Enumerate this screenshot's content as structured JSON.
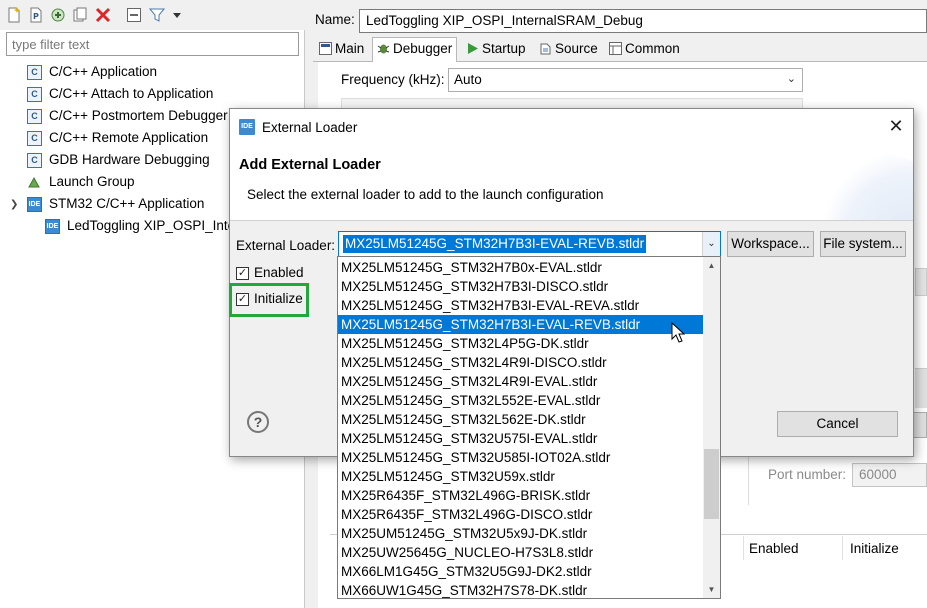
{
  "left_panel": {
    "toolbar_icons": [
      "new-config-icon",
      "new-proto-icon",
      "duplicate-icon",
      "export-icon",
      "delete-icon",
      "collapse-all-icon",
      "filter-icon",
      "view-menu-icon"
    ],
    "filter": {
      "placeholder": "type filter text",
      "value": ""
    },
    "tree": {
      "cpp_app": "C/C++ Application",
      "cpp_attach": "C/C++ Attach to Application",
      "cpp_postmortem": "C/C++ Postmortem Debugger",
      "cpp_remote": "C/C++ Remote Application",
      "gdb_hw": "GDB Hardware Debugging",
      "launch_group": "Launch Group",
      "stm32_app": "STM32 C/C++ Application",
      "selected_config": "LedToggling XIP_OSPI_InternalSRAM_Debug"
    }
  },
  "config": {
    "name_label": "Name:",
    "name_value": "LedToggling XIP_OSPI_InternalSRAM_Debug",
    "tabs": {
      "main": "Main",
      "debugger": "Debugger",
      "startup": "Startup",
      "source": "Source",
      "common": "Common"
    },
    "active_tab": "Debugger",
    "frequency_label": "Frequency (kHz):",
    "frequency_value": "Auto",
    "port_label": "Port number:",
    "port_value": "60000",
    "table_headers": {
      "enabled": "Enabled",
      "initialize": "Initialize"
    }
  },
  "dialog": {
    "title": "External Loader",
    "icon_text": "IDE",
    "header_title": "Add External Loader",
    "header_desc": "Select the external loader to add to the launch configuration",
    "external_loader_label": "External Loader:",
    "external_loader_value": "MX25LM51245G_STM32H7B3I-EVAL-REVB.stldr",
    "workspace_button": "Workspace...",
    "filesystem_button": "File system...",
    "enabled_label": "Enabled",
    "enabled_checked": true,
    "initialize_label": "Initialize",
    "initialize_checked": true,
    "cancel_button": "Cancel",
    "help_icon": "?",
    "close_icon": "✕"
  },
  "dropdown": {
    "items": [
      "MX25LM51245G_STM32H7B0x-EVAL.stldr",
      "MX25LM51245G_STM32H7B3I-DISCO.stldr",
      "MX25LM51245G_STM32H7B3I-EVAL-REVA.stldr",
      "MX25LM51245G_STM32H7B3I-EVAL-REVB.stldr",
      "MX25LM51245G_STM32L4P5G-DK.stldr",
      "MX25LM51245G_STM32L4R9I-DISCO.stldr",
      "MX25LM51245G_STM32L4R9I-EVAL.stldr",
      "MX25LM51245G_STM32L552E-EVAL.stldr",
      "MX25LM51245G_STM32L562E-DK.stldr",
      "MX25LM51245G_STM32U575I-EVAL.stldr",
      "MX25LM51245G_STM32U585I-IOT02A.stldr",
      "MX25LM51245G_STM32U59x.stldr",
      "MX25R6435F_STM32L496G-BRISK.stldr",
      "MX25R6435F_STM32L496G-DISCO.stldr",
      "MX25UM51245G_STM32U5x9J-DK.stldr",
      "MX25UW25645G_NUCLEO-H7S3L8.stldr",
      "MX66LM1G45G_STM32U5G9J-DK2.stldr",
      "MX66UW1G45G_STM32H7S78-DK.stldr"
    ],
    "selected_index": 3
  },
  "colors": {
    "selection": "#0078d7",
    "highlight_box": "#22a83a",
    "delete_icon": "#d9262a"
  }
}
